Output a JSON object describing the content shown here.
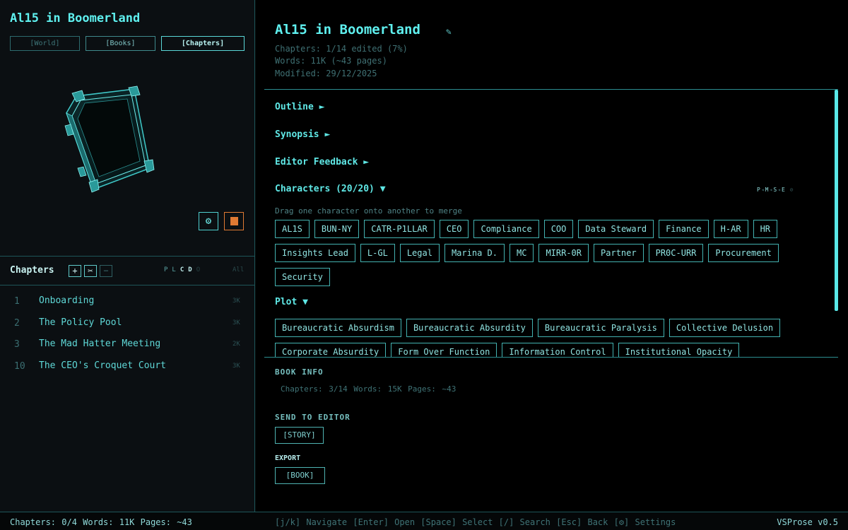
{
  "sidebar": {
    "book_title": "Al15 in Boomerland",
    "tabs": [
      "[World]",
      "[Books]",
      "[Chapters]"
    ],
    "gear_icon": "gear-icon",
    "stop_icon": "stop-icon",
    "chapters_label": "Chapters",
    "chapter_buttons": [
      "+",
      "✂",
      "−"
    ],
    "filters": {
      "p": "P",
      "l": "L",
      "c": "C",
      "d": "D",
      "o": "O",
      "all": "All"
    },
    "chapters": [
      {
        "num": "1",
        "title": "Onboarding",
        "size": "3K"
      },
      {
        "num": "2",
        "title": "The Policy Pool",
        "size": "3K"
      },
      {
        "num": "3",
        "title": "The Mad Hatter Meeting",
        "size": "2K"
      },
      {
        "num": "10",
        "title": "The CEO's Croquet Court",
        "size": "3K"
      }
    ]
  },
  "main": {
    "title": "Al15 in Boomerland",
    "edit_icon": "✎",
    "meta": [
      "Chapters: 1/14 edited (7%)",
      "Words: 11K (~43 pages)",
      "Modified: 29/12/2025"
    ],
    "sections": {
      "outline": "Outline ►",
      "synopsis": "Synopsis ►",
      "feedback": "Editor Feedback ►",
      "characters": "Characters (20/20) ▼",
      "plot": "Plot ▼"
    },
    "character_filters": {
      "p": "P",
      "m": "M",
      "s": "S",
      "e": "E",
      "o": "⊘"
    },
    "merge_hint": "Drag one character onto another to merge",
    "characters": [
      [
        "AL1S",
        "BUN-NY",
        "CATR-P1LLAR",
        "CEO",
        "Compliance",
        "COO",
        "Data Steward",
        "Finance",
        "H-AR",
        "HR"
      ],
      [
        "Insights Lead",
        "L-GL",
        "Legal",
        "Marina D.",
        "MC",
        "MIRR-0R",
        "Partner",
        "PR0C-URR",
        "Procurement"
      ],
      [
        "Security"
      ]
    ],
    "plot": [
      [
        "Bureaucratic Absurdism",
        "Bureaucratic Absurdity",
        "Bureaucratic Paralysis",
        "Collective Delusion"
      ],
      [
        "Corporate Absurdity",
        "Form Over Function",
        "Information Control",
        "Institutional Opacity"
      ]
    ],
    "book_info_label": "BOOK INFO",
    "book_info": "Chapters: 3/14  Words: 15K  Pages: ~43",
    "send_label": "SEND TO EDITOR",
    "story_button": "[STORY]",
    "export_label": "EXPORT",
    "book_button": "[BOOK]"
  },
  "status": {
    "left": "Chapters: 0/4  Words: 11K  Pages: ~43",
    "keys": "[j/k] Navigate  [Enter] Open  [Space] Select  [/] Search  [Esc] Back  [⚙] Settings",
    "version": "VSProse v0.5"
  }
}
